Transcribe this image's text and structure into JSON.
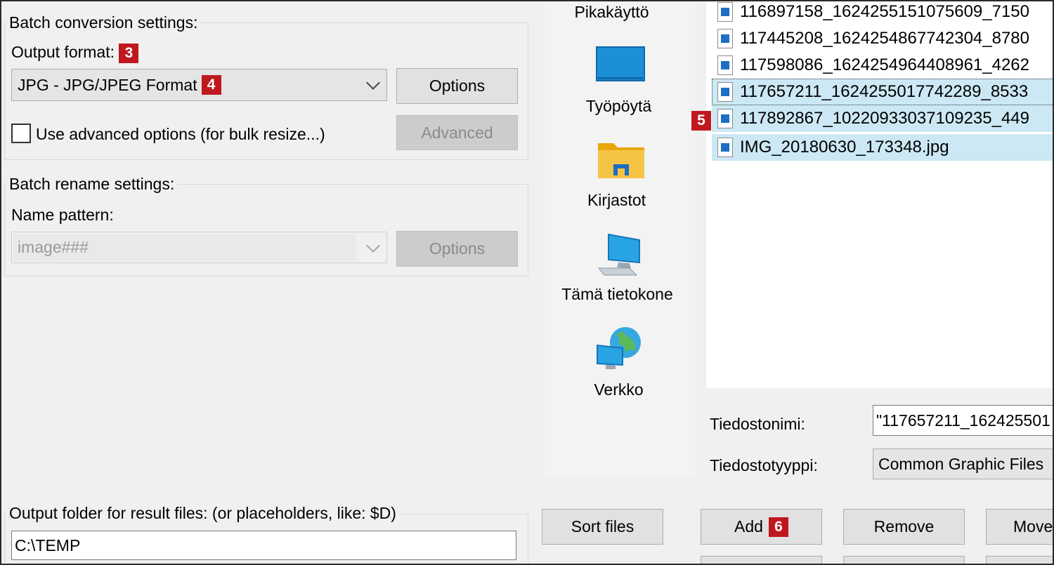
{
  "conversion": {
    "group_title": "Batch conversion settings:",
    "output_format_label": "Output format:",
    "badge_3": "3",
    "format_value": "JPG - JPG/JPEG Format",
    "badge_4": "4",
    "options_label": "Options",
    "advanced_checkbox_label": "Use advanced options (for bulk resize...)",
    "advanced_button_label": "Advanced"
  },
  "rename": {
    "group_title": "Batch rename settings:",
    "name_pattern_label": "Name pattern:",
    "pattern_value": "image###",
    "options_label": "Options"
  },
  "output": {
    "label": "Output folder for result files: (or placeholders, like: $D)",
    "value": "C:\\TEMP"
  },
  "places": [
    {
      "label": "Pikakäyttö",
      "icon": "quick-access-icon"
    },
    {
      "label": "Työpöytä",
      "icon": "desktop-icon"
    },
    {
      "label": "Kirjastot",
      "icon": "libraries-icon"
    },
    {
      "label": "Tämä tietokone",
      "icon": "this-pc-icon"
    },
    {
      "label": "Verkko",
      "icon": "network-icon"
    }
  ],
  "files": [
    {
      "name": "116897158_1624255151075609_7150",
      "selected": false
    },
    {
      "name": "117445208_1624254867742304_8780",
      "selected": false
    },
    {
      "name": "117598086_1624254964408961_4262",
      "selected": false
    },
    {
      "name": "117657211_1624255017742289_8533",
      "selected": true
    },
    {
      "name": "117892867_10220933037109235_449",
      "selected": true
    },
    {
      "name": "IMG_20180630_173348.jpg",
      "selected": true
    }
  ],
  "badge_5": "5",
  "filename_label": "Tiedostonimi:",
  "filename_value": "\"117657211_162425501",
  "filetype_label": "Tiedostotyyppi:",
  "filetype_value": "Common Graphic Files",
  "buttons": {
    "sort": "Sort files",
    "add": "Add",
    "badge_6": "6",
    "remove": "Remove",
    "move": "Move"
  },
  "colors": {
    "badge": "#c0181f",
    "selection": "#cce8f5"
  }
}
